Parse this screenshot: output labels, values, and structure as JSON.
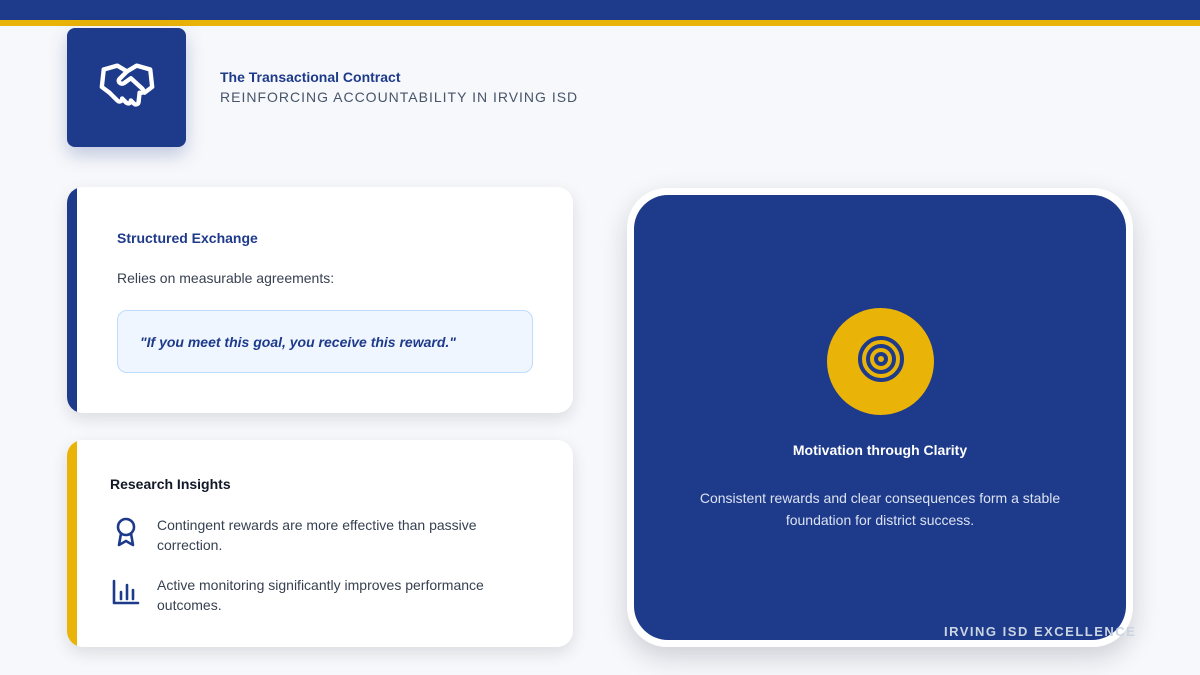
{
  "header": {
    "title": "The Transactional Contract",
    "subtitle": "REINFORCING ACCOUNTABILITY IN IRVING ISD",
    "logo_icon": "handshake-icon"
  },
  "exchange_card": {
    "heading": "Structured Exchange",
    "text": "Relies on measurable agreements:",
    "quote": "\"If you meet this goal, you receive this reward.\""
  },
  "research_card": {
    "heading": "Research Insights",
    "items": [
      {
        "icon": "award-ribbon-icon",
        "text": "Contingent rewards are more effective than passive correction."
      },
      {
        "icon": "bar-chart-icon",
        "text": "Active monitoring significantly improves performance outcomes."
      }
    ]
  },
  "motivation_card": {
    "icon": "target-icon",
    "title": "Motivation through Clarity",
    "text": "Consistent rewards and clear consequences form a stable foundation for district success."
  },
  "footer": {
    "mark": "IRVING ISD EXCELLENCE"
  },
  "colors": {
    "primary": "#1e3a8a",
    "accent": "#eab308",
    "background": "#f7f8fb"
  }
}
